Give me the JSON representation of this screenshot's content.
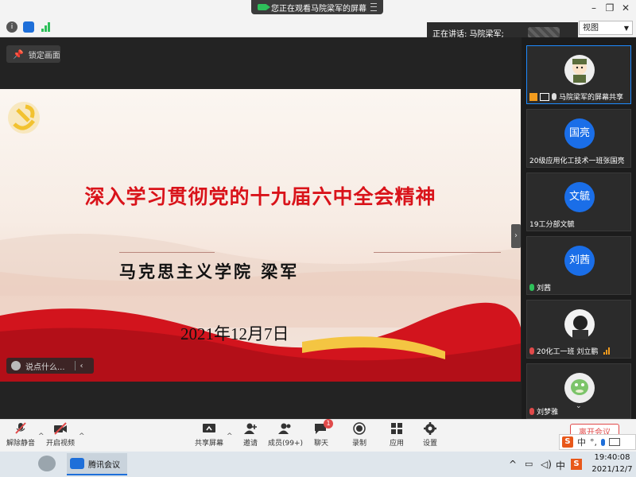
{
  "window": {
    "share_notice": "您正在观看马院梁军的屏幕",
    "speaker_label": "正在讲话: 马院梁军;",
    "view_mode": "视图"
  },
  "main": {
    "lock_label": "锁定画面",
    "chat_placeholder": "说点什么..."
  },
  "slide": {
    "title": "深入学习贯彻党的十九届六中全会精神",
    "author": "马克思主义学院  梁军",
    "date": "2021年12月7日",
    "accent_color": "#d9131a"
  },
  "participants": [
    {
      "name": "马院梁军的屏幕共享",
      "avatar": "",
      "avatar_kind": "cartoon-boy",
      "status": "sharing"
    },
    {
      "name": "20级应用化工技术一班张国亮",
      "avatar": "国亮",
      "status": "none"
    },
    {
      "name": "19工分部文毓",
      "avatar": "文毓",
      "status": "none"
    },
    {
      "name": "刘茜",
      "avatar": "刘茜",
      "status": "mic-on"
    },
    {
      "name": "20化工一班 刘立鹏",
      "avatar": "",
      "avatar_kind": "photo-dark",
      "status": "muted-speaking"
    },
    {
      "name": "刘梦雅",
      "avatar": "",
      "avatar_kind": "green-dino",
      "status": "muted"
    }
  ],
  "toolbar": {
    "mute": "解除静音",
    "video": "开启视频",
    "share": "共享屏幕",
    "invite": "邀请",
    "members": "成员(99+)",
    "chat": "聊天",
    "chat_badge": "1",
    "record": "录制",
    "apps": "应用",
    "settings": "设置",
    "leave": "离开会议"
  },
  "ime": {
    "mode": "中"
  },
  "taskbar": {
    "app_label": "腾讯会议",
    "input_mode": "中",
    "time": "19:40:08",
    "date": "2021/12/7"
  }
}
